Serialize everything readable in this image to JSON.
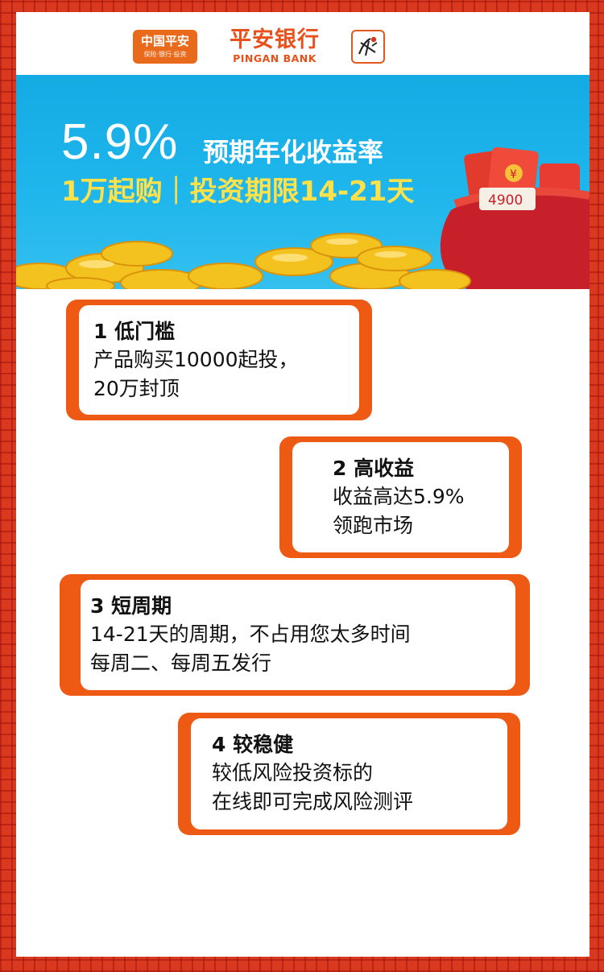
{
  "logos": {
    "group_name": "中国平安",
    "group_tagline": "保险·银行·投资",
    "bank_cn": "平安银行",
    "bank_en": "PINGAN BANK",
    "stamp_icon": "stamp-seal-icon"
  },
  "banner": {
    "rate": "5.9%",
    "rate_label": "预期年化收益率",
    "subtitle": "1万起购｜投资期限14-21天",
    "bag_amount": "4900",
    "colors": {
      "sky": "#1fb6ec",
      "highlight": "#ffe24a",
      "bag": "#c8202a"
    }
  },
  "features": [
    {
      "title": "1  低门槛",
      "lines": [
        "产品购买10000起投，",
        "20万封顶"
      ]
    },
    {
      "title": "2  高收益",
      "lines": [
        "收益高达5.9%",
        "领跑市场"
      ]
    },
    {
      "title": "3  短周期",
      "lines": [
        "14-21天的周期，不占用您太多时间",
        "每周二、每周五发行"
      ]
    },
    {
      "title": "4  较稳健",
      "lines": [
        "较低风险投资标的",
        "在线即可完成风险测评"
      ]
    }
  ],
  "colors": {
    "frame": "#d9391f",
    "card_border": "#ee5a14",
    "brand_orange": "#e8501c"
  }
}
